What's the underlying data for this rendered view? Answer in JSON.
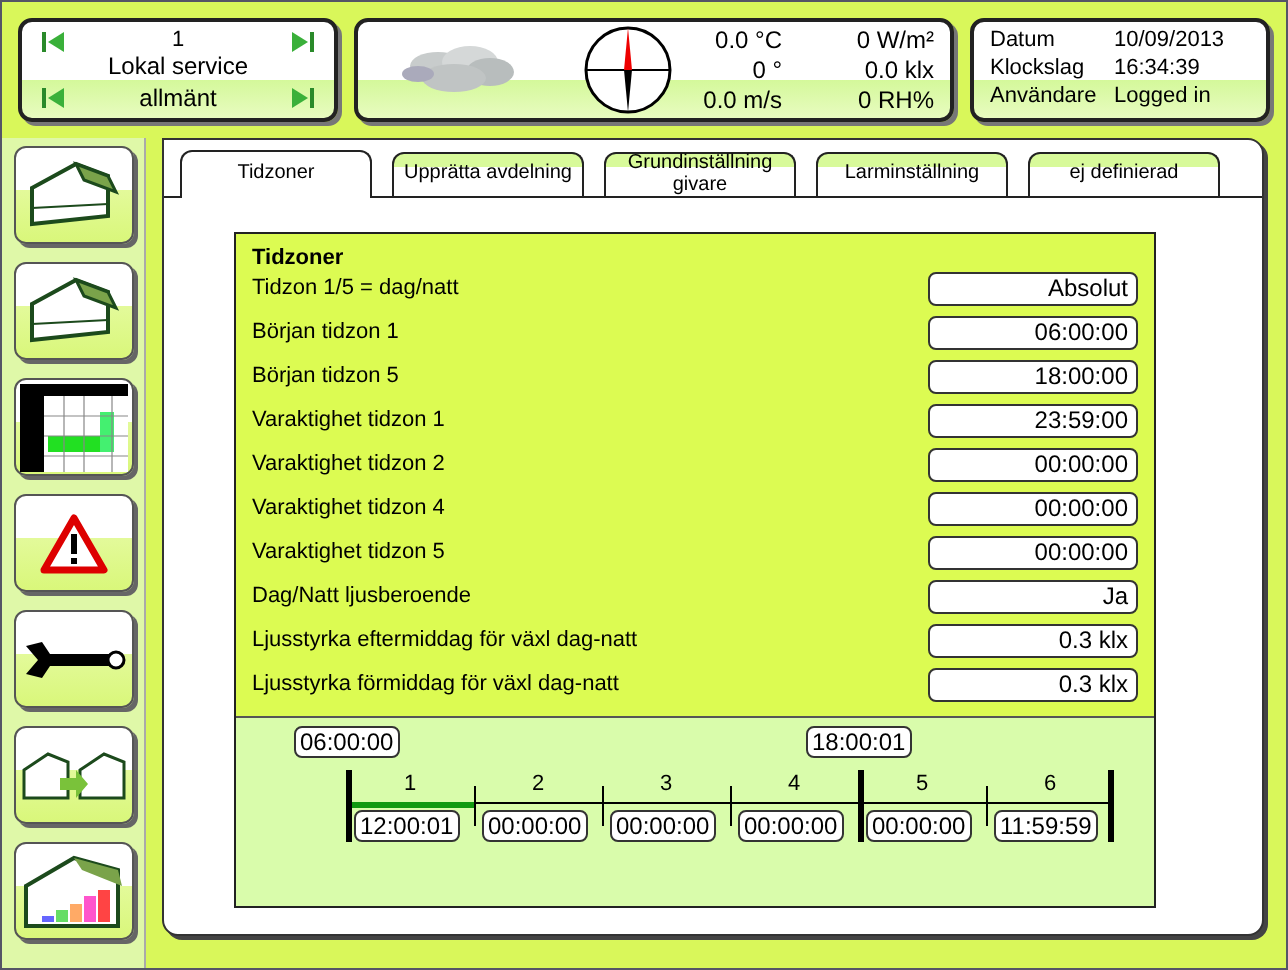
{
  "section_selector": {
    "number": "1",
    "title": "Lokal service",
    "subtitle": "allmänt"
  },
  "weather": {
    "temperature": "0.0 °C",
    "radiation": "0 W/m²",
    "wind_direction": "0 °",
    "light": "0.0 klx",
    "wind_speed": "0.0 m/s",
    "humidity": "0 RH%"
  },
  "status": [
    {
      "label": "Datum",
      "value": "10/09/2013"
    },
    {
      "label": "Klockslag",
      "value": "16:34:39"
    },
    {
      "label": "Användare",
      "value": "Logged in"
    }
  ],
  "sidebar": {
    "items": [
      {
        "kind": "house"
      },
      {
        "kind": "house"
      },
      {
        "kind": "chart"
      },
      {
        "kind": "alarm"
      },
      {
        "kind": "wrench"
      },
      {
        "kind": "copy"
      },
      {
        "kind": "bars"
      }
    ]
  },
  "tabs": [
    {
      "label": "Tidzoner",
      "selected": true
    },
    {
      "label": "Upprätta avdelning",
      "selected": false
    },
    {
      "label": "Grundinställning givare",
      "selected": false
    },
    {
      "label": "Larminställning",
      "selected": false
    },
    {
      "label": "ej definierad",
      "selected": false
    }
  ],
  "panel": {
    "title": "Tidzoner",
    "rows": [
      {
        "label": "Tidzon 1/5 = dag/natt",
        "value": "Absolut"
      },
      {
        "label": "Början tidzon 1",
        "value": "06:00:00"
      },
      {
        "label": "Början tidzon 5",
        "value": "18:00:00"
      },
      {
        "label": "Varaktighet tidzon 1",
        "value": "23:59:00"
      },
      {
        "label": "Varaktighet tidzon 2",
        "value": "00:00:00"
      },
      {
        "label": "Varaktighet tidzon 4",
        "value": "00:00:00"
      },
      {
        "label": "Varaktighet tidzon 5",
        "value": "00:00:00"
      },
      {
        "label": "Dag/Natt ljusberoende",
        "value": "Ja"
      },
      {
        "label": "Ljusstyrka eftermiddag för växl dag-natt",
        "value": "0.3  klx"
      },
      {
        "label": "Ljusstyrka förmiddag för växl dag-natt",
        "value": "0.3  klx"
      }
    ]
  },
  "timeline": {
    "segments": [
      {
        "number": "1",
        "duration": "12:00:01",
        "marker": "06:00:00",
        "active": true
      },
      {
        "number": "2",
        "duration": "00:00:00",
        "active": false
      },
      {
        "number": "3",
        "duration": "00:00:00",
        "active": false
      },
      {
        "number": "4",
        "duration": "00:00:00",
        "active": false
      },
      {
        "number": "5",
        "duration": "00:00:00",
        "marker": "18:00:01",
        "active": false
      },
      {
        "number": "6",
        "duration": "11:59:59",
        "active": false
      }
    ]
  }
}
